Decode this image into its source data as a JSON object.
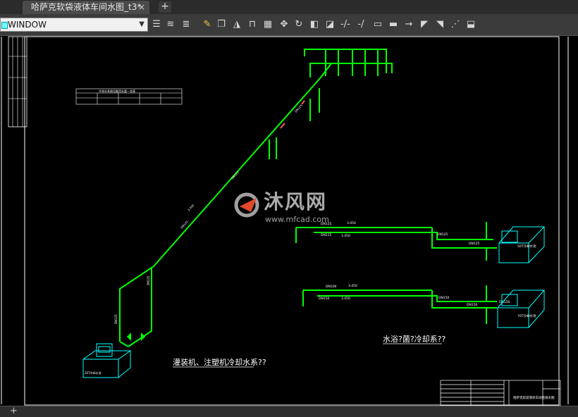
{
  "tab": {
    "title": "哈萨克软袋液体车间水图_t3*",
    "close": "×",
    "add": "+"
  },
  "toolbar": {
    "layer_name": "WINDOW",
    "icons": [
      "layers-icon",
      "layer-properties-icon",
      "layer-state-icon",
      "pencil-icon",
      "copy-icon",
      "mirror-icon",
      "offset-icon",
      "array-icon",
      "move-icon",
      "rotate-icon",
      "scale-icon",
      "stretch-icon",
      "trim-icon",
      "extend-icon",
      "break-icon",
      "join-icon",
      "chamfer-icon",
      "fillet-icon",
      "explode-icon",
      "block-icon"
    ]
  },
  "drawing": {
    "colors": {
      "pipe": "#00ff00",
      "equipment": "#00ffff",
      "text": "#ffffff",
      "frame": "#ffffff"
    },
    "title1": "灌装机、注塑机冷却水系??",
    "title2": "水浴?菌?冷却系??",
    "pipe_labels": {
      "dn125_a": "DN125",
      "dn125_b": "DN125",
      "dn125_c": "DN125",
      "dn125_d": "DN125",
      "dn100_a": "DN100",
      "dn150_a": "DN150",
      "dn150_b": "DN150",
      "dn150_c": "DN150",
      "dn150_d": "DN150",
      "tank1": "50T冷却水池",
      "tank2": "70T冷却水池",
      "tank3": "20T冷却水池"
    },
    "legend_table_title": "冷却水系统设备用水量一览表",
    "titleblock_text": "哈萨克软袋液体车间给排水图"
  },
  "watermark": {
    "title": "沐风网",
    "url": "www.mfcad.com"
  },
  "status": {
    "add": "+"
  }
}
